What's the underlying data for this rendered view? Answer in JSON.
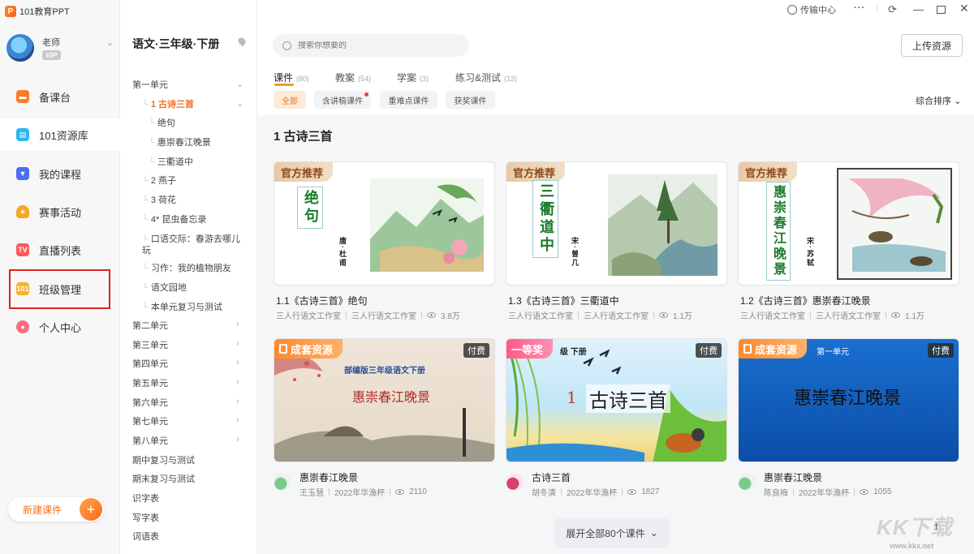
{
  "app": {
    "brand_name": "101教育PPT",
    "brand_logo_letter": "P"
  },
  "profile": {
    "name": "老师",
    "vip_label": "VIP"
  },
  "nav": [
    {
      "label": "备课台",
      "icon": "desk-icon",
      "color": "#ff7a2c"
    },
    {
      "label": "101资源库",
      "icon": "library-icon",
      "color": "#2fb5f0"
    },
    {
      "label": "我的课程",
      "icon": "course-icon",
      "color": "#4a6cf7"
    },
    {
      "label": "赛事活动",
      "icon": "trophy-icon",
      "color": "#f5a623"
    },
    {
      "label": "直播列表",
      "icon": "tv-icon",
      "color": "#ff5a5a"
    },
    {
      "label": "班级管理",
      "icon": "class-icon",
      "color": "#f5b32c"
    },
    {
      "label": "个人中心",
      "icon": "user-icon",
      "color": "#ff6b7a"
    }
  ],
  "new_course_label": "新建课件",
  "topbar": {
    "transfer_label": "传输中心",
    "more_label": "···"
  },
  "tree": {
    "title": "语文·三年级·下册",
    "items": [
      {
        "label": "第一单元"
      },
      {
        "label": "1 古诗三首"
      },
      {
        "label": "绝句"
      },
      {
        "label": "惠崇春江晚景"
      },
      {
        "label": "三衢道中"
      },
      {
        "label": "2 燕子"
      },
      {
        "label": "3 荷花"
      },
      {
        "label": "4* 昆虫备忘录"
      },
      {
        "label": "口语交际：春游去哪儿玩"
      },
      {
        "label": "习作：我的植物朋友"
      },
      {
        "label": "语文园地"
      },
      {
        "label": "本单元复习与测试"
      },
      {
        "label": "第二单元"
      },
      {
        "label": "第三单元"
      },
      {
        "label": "第四单元"
      },
      {
        "label": "第五单元"
      },
      {
        "label": "第六单元"
      },
      {
        "label": "第七单元"
      },
      {
        "label": "第八单元"
      },
      {
        "label": "期中复习与测试"
      },
      {
        "label": "期末复习与测试"
      },
      {
        "label": "识字表"
      },
      {
        "label": "写字表"
      },
      {
        "label": "词语表"
      }
    ]
  },
  "search": {
    "placeholder": "搜索你想要的"
  },
  "upload_label": "上传资源",
  "tabs": [
    {
      "label": "课件",
      "count": "(80)"
    },
    {
      "label": "教案",
      "count": "(54)"
    },
    {
      "label": "学案",
      "count": "(3)"
    },
    {
      "label": "练习&测试",
      "count": "(13)"
    }
  ],
  "chips": [
    "全部",
    "含讲稿课件",
    "重难点课件",
    "获奖课件"
  ],
  "sort_label": "综合排序",
  "section_title": "1 古诗三首",
  "cards": [
    {
      "badge": "官方推荐",
      "cover_title": "绝句",
      "cover_author": "唐·杜甫",
      "title": "1.1《古诗三首》绝句",
      "meta1": "三人行语文工作室",
      "meta2": "三人行语文工作室",
      "views": "3.8万"
    },
    {
      "badge": "官方推荐",
      "cover_title": "三衢道中",
      "cover_author": "宋·曾几",
      "title": "1.3《古诗三首》三衢道中",
      "meta1": "三人行语文工作室",
      "meta2": "三人行语文工作室",
      "views": "1.1万"
    },
    {
      "badge": "官方推荐",
      "cover_title": "惠崇春江晚景",
      "cover_author": "宋·苏轼",
      "title": "1.2《古诗三首》惠崇春江晚景",
      "meta1": "三人行语文工作室",
      "meta2": "三人行语文工作室",
      "views": "1.1万"
    },
    {
      "badge": "成套资源",
      "paid": "付费",
      "cover_sub": "部编版三年级语文下册",
      "cover_title": "惠崇春江晚景",
      "title": "惠崇春江晚景",
      "meta1": "王玉慧",
      "meta2": "2022年华渔杯",
      "views": "2110"
    },
    {
      "badge": "一等奖",
      "paid": "付费",
      "cover_sub": "级 下册",
      "cover_title": "古诗三首",
      "cover_num": "1",
      "title": "古诗三首",
      "meta1": "胡冬清",
      "meta2": "2022年华渔杯",
      "views": "1827"
    },
    {
      "badge": "成套资源",
      "paid": "付费",
      "cover_sub": "第一单元",
      "cover_title": "惠崇春江晚景",
      "title": "惠崇春江晚景",
      "meta1": "陈良梅",
      "meta2": "2022年华渔杯",
      "views": "1055"
    }
  ],
  "expand_label": "展开全部80个课件",
  "watermark": {
    "main": "KK下载",
    "sub": "www.kkx.net"
  }
}
